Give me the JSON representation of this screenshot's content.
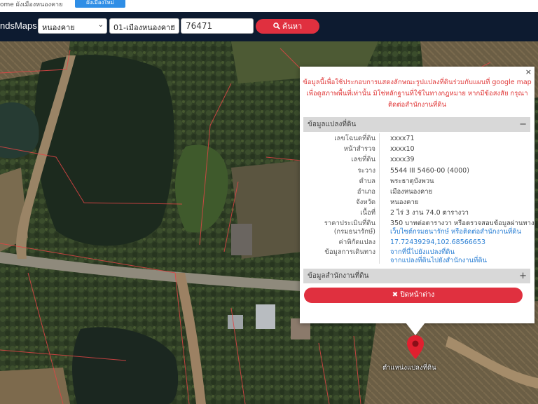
{
  "top_strip": {
    "crumb_text": "ome  ผังเมืองหนองคาย",
    "blue_button_label": "ผังเมืองใหม่"
  },
  "navbar": {
    "brand": "ndsMaps",
    "province_select": "หนองคาย",
    "district_select": "01-เมืองหนองคาย",
    "parcel_number": "76471",
    "search_label": "ค้นหา"
  },
  "popup": {
    "notice": "ข้อมูลนี้เพื่อใช้ประกอบการแสดงลักษณะรูปแปลงที่ดินร่วมกับแผนที่ google map เพื่อดูสภาพพื้นที่เท่านั้น มิใช่หลักฐานที่ใช้ในทางกฎหมาย หากมีข้อสงสัย กรุณาติดต่อสำนักงานที่ดิน",
    "section_parcel": "ข้อมูลแปลงที่ดิน",
    "section_parcel_toggle": "−",
    "section_office": "ข้อมูลสำนักงานที่ดิน",
    "section_office_toggle": "+",
    "rows": [
      {
        "label": "เลขโฉนดที่ดิน",
        "value": "xxxx71"
      },
      {
        "label": "หน้าสำรวจ",
        "value": "xxxx10"
      },
      {
        "label": "เลขที่ดิน",
        "value": "xxxx39"
      },
      {
        "label": "ระวาง",
        "value": "5544 III 5460-00 (4000)"
      },
      {
        "label": "ตำบล",
        "value": "พระธาตุบังพวน"
      },
      {
        "label": "อำเภอ",
        "value": "เมืองหนองคาย"
      },
      {
        "label": "จังหวัด",
        "value": "หนองคาย"
      },
      {
        "label": "เนื้อที่",
        "value": "2 ไร่ 3 งาน 74.0 ตารางวา"
      }
    ],
    "price_label_1": "ราคาประเมินที่ดิน",
    "price_label_2": "(กรมธนารักษ์)",
    "price_value_1": "350 บาทต่อตารางวา หรือตรวจสอบข้อมูลผ่านทาง",
    "price_value_2": "เว็บไซต์กรมธนารักษ์ หรือติดต่อสำนักงานที่ดิน",
    "coord_label": "ค่าพิกัดแปลง",
    "coord_value": "17.72439294,102.68566653",
    "route_label": "ข้อมูลการเดินทาง",
    "route_value_1": "จากที่นี่ไปยังแปลงที่ดิน",
    "route_value_2": "จากแปลงที่ดินไปยังสำนักงานที่ดิน",
    "close_label": "ปิดหน้าต่าง",
    "close_x": "×"
  },
  "marker_label": "ตำแหน่งแปลงที่ดิน",
  "colors": {
    "nav_bg": "#0d1b30",
    "accent_red": "#e0303f",
    "accent_blue": "#2f8ee6",
    "link_blue": "#2a7fd4",
    "notice_red": "#e03a3a"
  }
}
